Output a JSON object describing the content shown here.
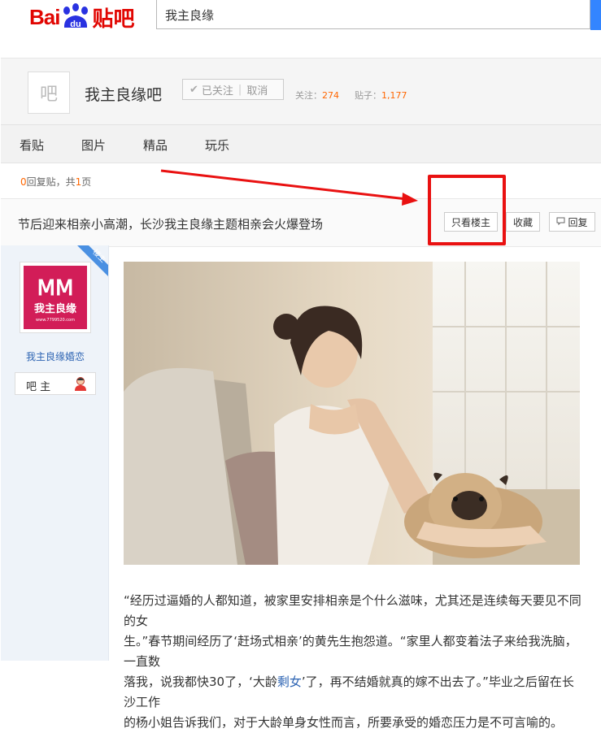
{
  "header": {
    "logo_left": "Bai",
    "logo_paw": "du",
    "logo_right": "贴吧",
    "search_value": "我主良缘"
  },
  "forum": {
    "avatar_char": "吧",
    "name": "我主良缘吧",
    "follow_label": "已关注",
    "cancel_label": "取消",
    "followers_label": "关注：",
    "followers": "274",
    "posts_label": "贴子：",
    "posts": "1,177"
  },
  "nav": {
    "items": [
      "看贴",
      "图片",
      "精品",
      "玩乐"
    ]
  },
  "pager": {
    "reply_count": "0",
    "reply_text": "回复贴，共",
    "page_count": "1",
    "page_suffix": "页"
  },
  "thread": {
    "title": "节后迎来相亲小高潮，长沙我主良缘主题相亲会火爆登场",
    "only_op_label": "只看楼主",
    "collect_label": "收藏",
    "reply_label": "回复"
  },
  "author": {
    "badge": "楼主",
    "logo_text": "我主良缘",
    "logo_url_text": "www.7799520.com",
    "name": "我主良缘婚恋",
    "role": "吧 主"
  },
  "post": {
    "line1": "“经历过逼婚的人都知道，被家里安排相亲是个什么滋味，尤其还是连续每天要见不同的女",
    "line2": "生。”春节期间经历了‘赶场式相亲’的黄先生抱怨道。“家里人都变着法子来给我洗脑，一直数",
    "line3a": "落我，说我都快30了，‘大龄",
    "line3_link": "剩女",
    "line3b": "’了，再不结婚就真的嫁不出去了。”毕业之后留在长沙工作",
    "line4": "的杨小姐告诉我们，对于大龄单身女性而言，所要承受的婚恋压力是不可言喻的。"
  },
  "colors": {
    "brand_red": "#e10602",
    "brand_blue": "#2932e1",
    "search_blue": "#3385ff",
    "annotation_red": "#e91111",
    "link_blue": "#2d64b3",
    "count_orange": "#ff6600"
  }
}
